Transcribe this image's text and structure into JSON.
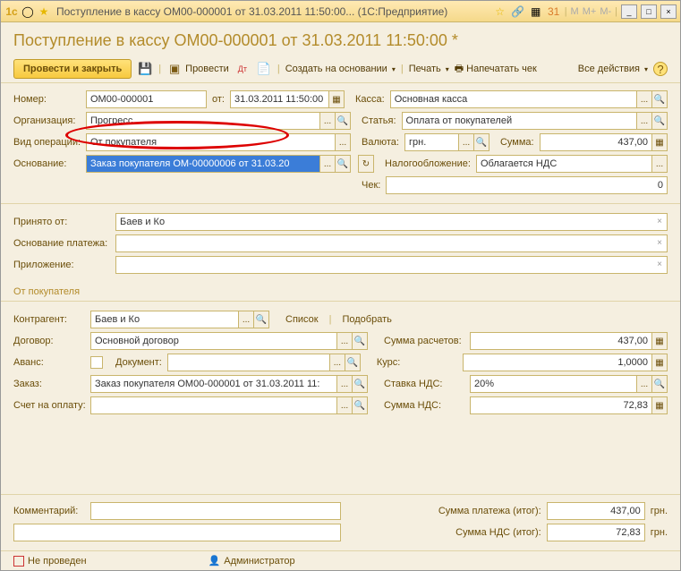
{
  "window": {
    "title": "Поступление в кассу ОМ00-000001 от 31.03.2011 11:50:00...  (1С:Предприятие)",
    "minimize": "_",
    "maximize": "□",
    "close": "×"
  },
  "calc": {
    "m": "M",
    "mplus": "M+",
    "mminus": "M-"
  },
  "header": {
    "title": "Поступление в кассу ОМ00-000001 от 31.03.2011 11:50:00 *"
  },
  "toolbar": {
    "post_close": "Провести и закрыть",
    "post": "Провести",
    "create_based": "Создать на основании",
    "print": "Печать",
    "print_check": "Напечатать чек",
    "all_actions": "Все действия",
    "help": "?"
  },
  "fields": {
    "number_label": "Номер:",
    "number": "ОМ00-000001",
    "date_label": "от:",
    "date": "31.03.2011 11:50:00",
    "kassa_label": "Касса:",
    "kassa": "Основная касса",
    "org_label": "Организация:",
    "org": "Прогресс",
    "article_label": "Статья:",
    "article": "Оплата от покупателей",
    "op_label": "Вид операции:",
    "op": "От покупателя",
    "currency_label": "Валюта:",
    "currency": "грн.",
    "sum_label": "Сумма:",
    "sum": "437,00",
    "basis_label": "Основание:",
    "basis": "Заказ покупателя ОМ-00000006 от 31.03.20",
    "tax_label": "Налогообложение:",
    "tax": "Облагается НДС",
    "check_label": "Чек:",
    "check": "0",
    "received_label": "Принято от:",
    "received": "Баев и Ко",
    "pay_basis_label": "Основание платежа:",
    "attachment_label": "Приложение:"
  },
  "buyer": {
    "section": "От покупателя",
    "counterparty_label": "Контрагент:",
    "counterparty": "Баев и Ко",
    "list": "Список",
    "select": "Подобрать",
    "contract_label": "Договор:",
    "contract": "Основной договор",
    "calc_sum_label": "Сумма расчетов:",
    "calc_sum": "437,00",
    "advance_label": "Аванс:",
    "doc_label": "Документ:",
    "rate_label": "Курс:",
    "rate": "1,0000",
    "order_label": "Заказ:",
    "order": "Заказ покупателя ОМ00-000001 от 31.03.2011 11:",
    "vat_rate_label": "Ставка НДС:",
    "vat_rate": "20%",
    "invoice_label": "Счет на оплату:",
    "vat_sum_label": "Сумма НДС:",
    "vat_sum": "72,83"
  },
  "bottom": {
    "comment_label": "Комментарий:",
    "total_label": "Сумма платежа (итог):",
    "total": "437,00",
    "vat_total_label": "Сумма НДС (итог):",
    "vat_total": "72,83",
    "unit": "грн."
  },
  "status": {
    "not_posted": "Не проведен",
    "admin": "Администратор"
  }
}
